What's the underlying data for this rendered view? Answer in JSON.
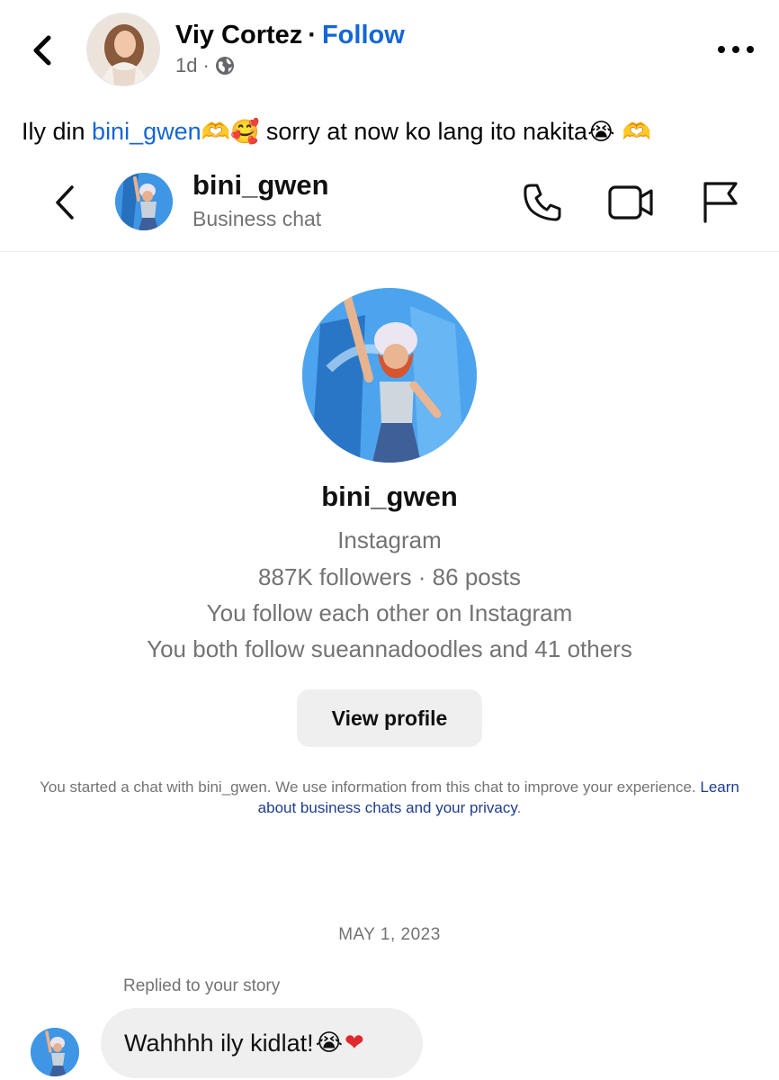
{
  "post": {
    "author_name": "Viy Cortez",
    "separator": "·",
    "follow_label": "Follow",
    "time": "1d",
    "time_separator": "·",
    "caption_prefix": "Ily din ",
    "caption_mention": "bini_gwen",
    "caption_emoji_1": "🫶🥰",
    "caption_text": " sorry at now ko lang ito nakita",
    "caption_emoji_2": "😭 🫶"
  },
  "chat": {
    "header": {
      "username": "bini_gwen",
      "subtitle": "Business chat"
    },
    "profile": {
      "username": "bini_gwen",
      "platform": "Instagram",
      "stats": "887K followers · 86 posts",
      "mutual_follow": "You follow each other on Instagram",
      "mutual_friends": "You both follow sueannadoodles and 41 others",
      "view_profile_label": "View profile"
    },
    "disclaimer": {
      "text": "You started a chat with bini_gwen. We use information from this chat to improve your experience. ",
      "link": "Learn about business chats and your privacy",
      "end": "."
    },
    "date_separator": "MAY 1, 2023",
    "reply_context": "Replied to your story",
    "message": {
      "text": "Wahhhh ily kidlat!",
      "emoji": "😭",
      "heart": "❤"
    }
  },
  "colors": {
    "link_blue": "#1566d6",
    "privacy_link": "#1e3d8f",
    "bubble_bg": "#efefef",
    "button_bg": "#efefef",
    "muted_text": "#737373",
    "heart_red": "#e0282e"
  },
  "icons": [
    "back-chevron-icon",
    "globe-icon",
    "more-dots-icon",
    "call-icon",
    "video-call-icon",
    "report-flag-icon"
  ]
}
